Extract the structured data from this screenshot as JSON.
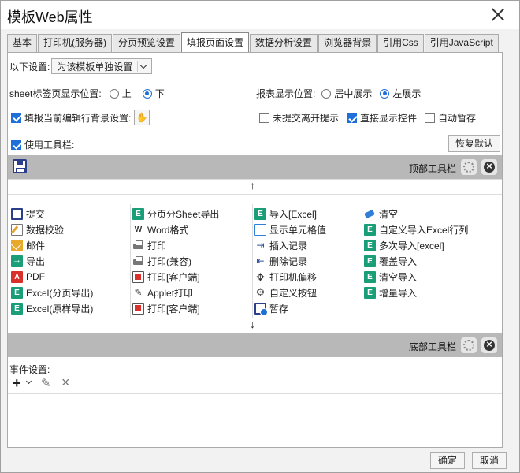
{
  "window": {
    "title": "模板Web属性"
  },
  "tabs": [
    {
      "label": "基本",
      "active": false
    },
    {
      "label": "打印机(服务器)",
      "active": false
    },
    {
      "label": "分页预览设置",
      "active": false
    },
    {
      "label": "填报页面设置",
      "active": true
    },
    {
      "label": "数据分析设置",
      "active": false
    },
    {
      "label": "浏览器背景",
      "active": false
    },
    {
      "label": "引用Css",
      "active": false
    },
    {
      "label": "引用JavaScript",
      "active": false
    }
  ],
  "settings": {
    "scope_label": "以下设置:",
    "scope_value": "为该模板单独设置",
    "sheet_position_label": "sheet标签页显示位置:",
    "sheet_top": "上",
    "sheet_bottom": "下",
    "report_position_label": "报表显示位置:",
    "report_center": "居中展示",
    "report_left": "左展示",
    "edit_row_bg_label": "填报当前编辑行背景设置:",
    "unsubmitted_leave_label": "未提交离开提示",
    "show_controls_label": "直接显示控件",
    "auto_save_label": "自动暂存",
    "use_toolbar_label": "使用工具栏:",
    "restore_default_label": "恢复默认"
  },
  "toolbar": {
    "top_label": "顶部工具栏",
    "bottom_label": "底部工具栏",
    "arrow_up": "↑",
    "arrow_down": "↓"
  },
  "items": [
    {
      "label": "提交",
      "icon": "save-icon"
    },
    {
      "label": "分页分Sheet导出",
      "icon": "excel-icon"
    },
    {
      "label": "导入[Excel]",
      "icon": "excel-icon"
    },
    {
      "label": "清空",
      "icon": "eraser-icon"
    },
    {
      "label": "数据校验",
      "icon": "check-wand-icon"
    },
    {
      "label": "Word格式",
      "icon": "word-icon"
    },
    {
      "label": "显示单元格值",
      "icon": "cell-icon"
    },
    {
      "label": "自定义导入Excel行列",
      "icon": "excel-icon"
    },
    {
      "label": "邮件",
      "icon": "mail-icon"
    },
    {
      "label": "打印",
      "icon": "printer-icon"
    },
    {
      "label": "插入记录",
      "icon": "insert-row-icon"
    },
    {
      "label": "多次导入[excel]",
      "icon": "excel-icon"
    },
    {
      "label": "导出",
      "icon": "export-icon"
    },
    {
      "label": "打印(兼容)",
      "icon": "printer-icon"
    },
    {
      "label": "删除记录",
      "icon": "delete-row-icon"
    },
    {
      "label": "覆盖导入",
      "icon": "excel-icon"
    },
    {
      "label": "PDF",
      "icon": "pdf-icon"
    },
    {
      "label": "打印[客户端]",
      "icon": "pdf-outline-icon"
    },
    {
      "label": "打印机偏移",
      "icon": "move-icon"
    },
    {
      "label": "清空导入",
      "icon": "excel-icon"
    },
    {
      "label": "Excel(分页导出)",
      "icon": "excel-icon"
    },
    {
      "label": "Applet打印",
      "icon": "applet-icon"
    },
    {
      "label": "自定义按钮",
      "icon": "cog-icon"
    },
    {
      "label": "增量导入",
      "icon": "excel-icon"
    },
    {
      "label": "Excel(原样导出)",
      "icon": "excel-icon"
    },
    {
      "label": "打印[客户端]",
      "icon": "pdf-outline-icon"
    },
    {
      "label": "暂存",
      "icon": "save-clock-icon"
    }
  ],
  "events": {
    "label": "事件设置:"
  },
  "footer": {
    "ok": "确定",
    "cancel": "取消"
  },
  "colors": {
    "accent": "#1e6fd9",
    "toolbar_bar": "#b8b8b8"
  }
}
